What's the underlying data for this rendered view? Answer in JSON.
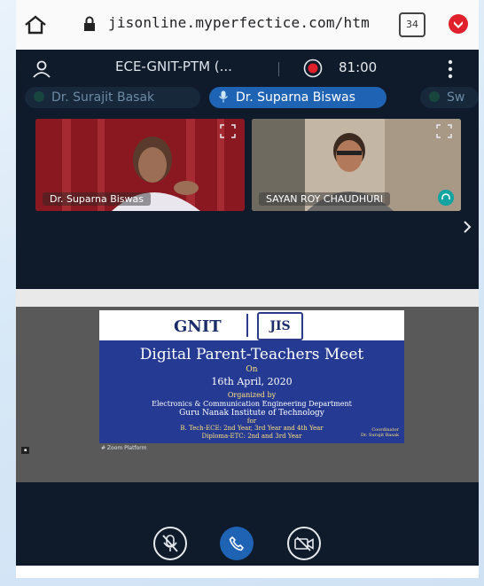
{
  "browser": {
    "url": "jisonline.myperfectice.com/htm",
    "tab_count": "34"
  },
  "meeting": {
    "title": "ECE-GNIT-PTM (...",
    "timer": "81:00",
    "speakers": [
      {
        "label": "Dr. Surajit Basak"
      },
      {
        "label": "Dr. Suparna Biswas"
      },
      {
        "label": "Sw"
      }
    ],
    "tiles": [
      {
        "name": "Dr. Suparna Biswas"
      },
      {
        "name": "SAYAN ROY CHAUDHURI"
      }
    ]
  },
  "slide": {
    "logo_left": "GNIT",
    "logo_right": "JIS",
    "title": "Digital Parent-Teachers Meet",
    "on": "On",
    "date": "16th April, 2020",
    "organized_by": "Organized by",
    "department": "Electronics & Communication Engineering Department",
    "institute": "Guru Nanak Institute of Technology",
    "for": "for",
    "programme_1": "B. Tech-ECE: 2nd Year, 3rd Year and 4th Year",
    "programme_2": "Diploma-ETC: 2nd and 3rd Year",
    "coordinator_label": "Coordinator",
    "coordinator_name": "Dr. Surajit Basak",
    "platform": "# Zoom Platform"
  },
  "colors": {
    "app_bg": "#0f1b2b",
    "accent_blue": "#1f63b5",
    "record_red": "#e0212b"
  }
}
